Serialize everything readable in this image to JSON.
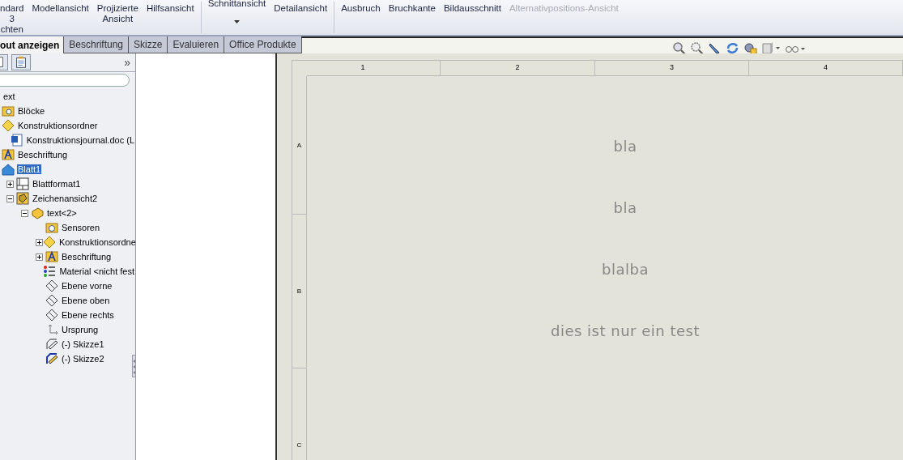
{
  "toolbar": {
    "buttons": [
      {
        "label": "ndard\n3\nchten",
        "disabled": false,
        "dropdown": false
      },
      {
        "label": "Modellansicht",
        "disabled": false,
        "dropdown": false
      },
      {
        "label": "Projizierte\nAnsicht",
        "disabled": false,
        "dropdown": false
      },
      {
        "label": "Hilfsansicht",
        "disabled": false,
        "dropdown": false
      },
      {
        "label": "Schnittansicht",
        "disabled": false,
        "dropdown": true
      },
      {
        "label": "Detailansicht",
        "disabled": false,
        "dropdown": false
      },
      {
        "label": "Ausbruch",
        "disabled": false,
        "dropdown": false
      },
      {
        "label": "Bruchkante",
        "disabled": false,
        "dropdown": false
      },
      {
        "label": "Bildausschnitt",
        "disabled": false,
        "dropdown": false
      },
      {
        "label": "Alternativpositions-Ansicht",
        "disabled": true,
        "dropdown": false
      }
    ]
  },
  "tabs": [
    {
      "label": "out anzeigen",
      "selected": true
    },
    {
      "label": "Beschriftung",
      "selected": false
    },
    {
      "label": "Skizze",
      "selected": false
    },
    {
      "label": "Evaluieren",
      "selected": false
    },
    {
      "label": "Office Produkte",
      "selected": false
    }
  ],
  "sidebar": {
    "more": "»",
    "tree": [
      {
        "label": "ext",
        "selected": false,
        "children": [
          {
            "label": "Blöcke",
            "kind": "folder",
            "selected": false
          },
          {
            "label": "Konstruktionsordner",
            "kind": "diamond",
            "selected": false,
            "children": [
              {
                "label": "Konstruktionsjournal.doc (L",
                "kind": "document",
                "selected": false
              }
            ]
          },
          {
            "label": "Beschriftung",
            "kind": "annotation",
            "selected": false
          },
          {
            "label": "Blatt1",
            "kind": "sheet",
            "selected": true,
            "children": [
              {
                "label": "Blattformat1",
                "kind": "format",
                "selected": false,
                "expanded": false
              },
              {
                "label": "Zeichenansicht2",
                "kind": "view",
                "selected": false,
                "expanded": true,
                "children": [
                  {
                    "label": "text<2>",
                    "kind": "part",
                    "selected": false,
                    "expanded": true,
                    "children": [
                      {
                        "label": "Sensoren",
                        "kind": "sensor",
                        "selected": false
                      },
                      {
                        "label": "Konstruktionsordne",
                        "kind": "diamond",
                        "selected": false,
                        "expanded": false
                      },
                      {
                        "label": "Beschriftung",
                        "kind": "annotation",
                        "selected": false,
                        "expanded": false
                      },
                      {
                        "label": "Material <nicht fest",
                        "kind": "material",
                        "selected": false
                      },
                      {
                        "label": "Ebene vorne",
                        "kind": "plane",
                        "selected": false
                      },
                      {
                        "label": "Ebene oben",
                        "kind": "plane",
                        "selected": false
                      },
                      {
                        "label": "Ebene rechts",
                        "kind": "plane",
                        "selected": false
                      },
                      {
                        "label": "Ursprung",
                        "kind": "origin",
                        "selected": false
                      },
                      {
                        "label": "(-) Skizze1",
                        "kind": "sketch",
                        "selected": false
                      },
                      {
                        "label": "(-) Skizze2",
                        "kind": "sketch-active",
                        "selected": false
                      }
                    ]
                  }
                ]
              }
            ]
          }
        ]
      }
    ]
  },
  "sheet": {
    "columns": [
      "1",
      "2",
      "3",
      "4"
    ],
    "rows": [
      "A",
      "B",
      "C"
    ],
    "notes": [
      "bla",
      "bla",
      "blalba",
      "dies ist nur ein test"
    ]
  }
}
